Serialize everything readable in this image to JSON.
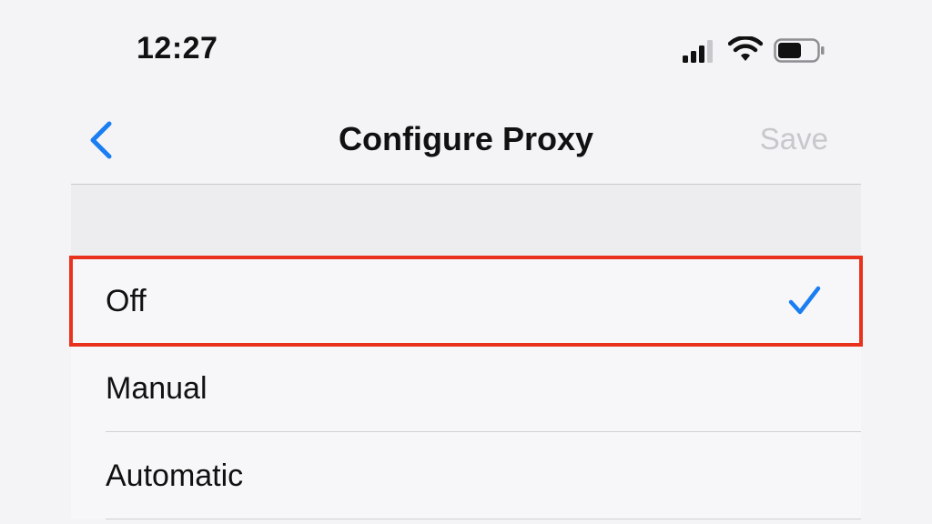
{
  "status_bar": {
    "time": "12:27",
    "icons": [
      "cellular-signal-icon",
      "wifi-icon",
      "battery-icon"
    ]
  },
  "nav": {
    "back_icon": "chevron-left-icon",
    "title": "Configure Proxy",
    "save_label": "Save"
  },
  "options": [
    {
      "label": "Off",
      "selected": true
    },
    {
      "label": "Manual",
      "selected": false
    },
    {
      "label": "Automatic",
      "selected": false
    }
  ],
  "colors": {
    "accent": "#1a7ef2",
    "highlight": "#e8321e",
    "disabled": "#c7c7cc"
  }
}
